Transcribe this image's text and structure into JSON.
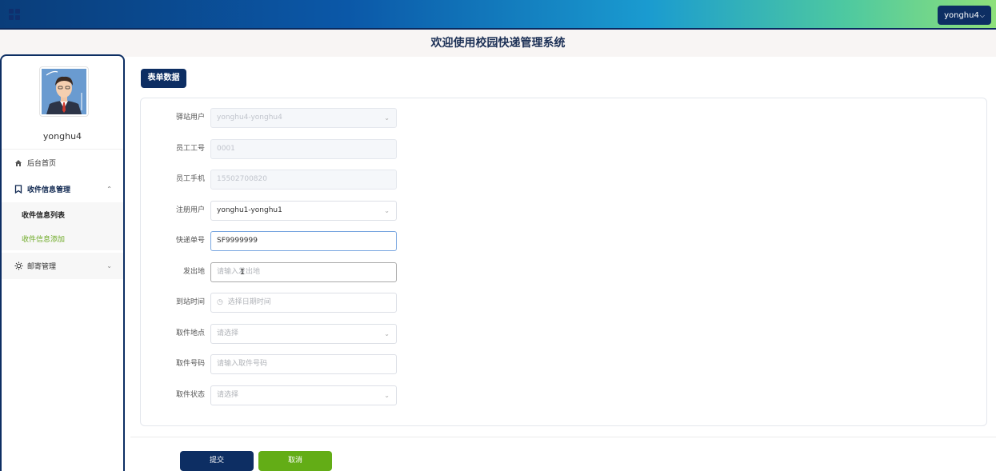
{
  "header": {
    "user_menu_label": "yonghu4",
    "system_title": "欢迎使用校园快递管理系统"
  },
  "sidebar": {
    "username": "yonghu4",
    "items": [
      {
        "label": "后台首页",
        "icon": "home-icon"
      },
      {
        "label": "收件信息管理",
        "icon": "bookmark-icon",
        "expanded": true,
        "children": [
          {
            "label": "收件信息列表",
            "active": false
          },
          {
            "label": "收件信息添加",
            "active": true
          }
        ]
      },
      {
        "label": "邮寄管理",
        "icon": "sun-icon",
        "expanded": false
      }
    ]
  },
  "main": {
    "tag_label": "表单数据",
    "form": {
      "station_user": {
        "label": "驿站用户",
        "value": "yonghu4-yonghu4"
      },
      "employee_no": {
        "label": "员工工号",
        "value": "0001"
      },
      "employee_phone": {
        "label": "员工手机",
        "value": "15502700820"
      },
      "register_user": {
        "label": "注册用户",
        "value": "yonghu1-yonghu1"
      },
      "tracking_no": {
        "label": "快递单号",
        "value": "SF9999999"
      },
      "origin": {
        "label": "发出地",
        "placeholder": "请输入发出地"
      },
      "arrival_time": {
        "label": "到站时间",
        "placeholder": "选择日期时间"
      },
      "pickup_place": {
        "label": "取件地点",
        "placeholder": "请选择"
      },
      "pickup_code": {
        "label": "取件号码",
        "placeholder": "请输入取件号码"
      },
      "pickup_status": {
        "label": "取件状态",
        "placeholder": "请选择"
      }
    },
    "submit_label": "提交",
    "cancel_label": "取消"
  },
  "colors": {
    "primary": "#0d2e63",
    "accent_green": "#63ad16",
    "active_menu": "#6ca924"
  }
}
